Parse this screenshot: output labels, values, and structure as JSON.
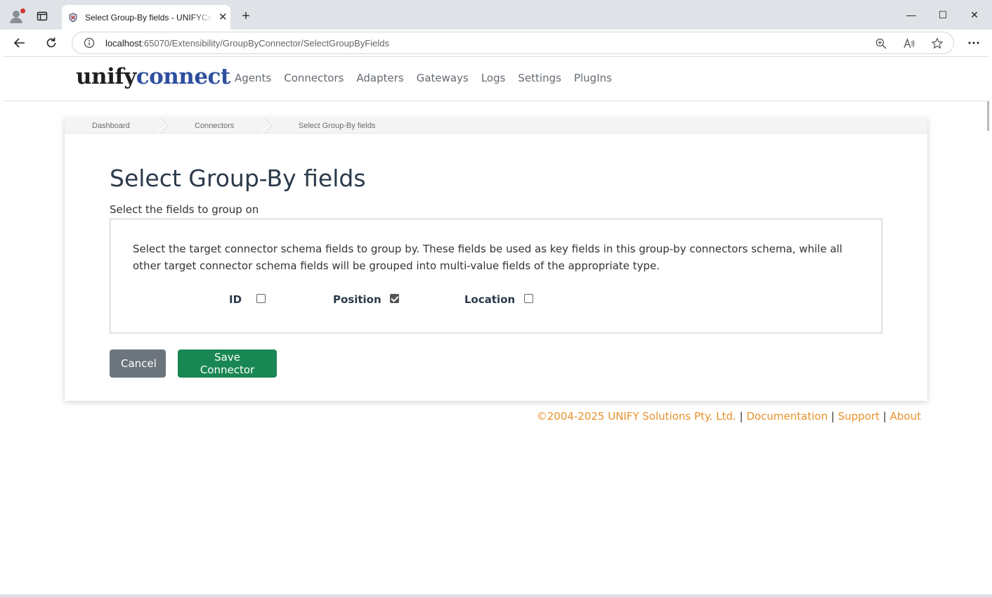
{
  "browser": {
    "tab_title": "Select Group-By fields - UNIFYConnect",
    "tab_close": "✕",
    "new_tab": "+",
    "url_host": "localhost",
    "url_rest": ":65070/Extensibility/GroupByConnector/SelectGroupByFields",
    "window_controls": {
      "minimize": "—",
      "maximize": "☐",
      "close": "✕"
    }
  },
  "brand": {
    "part1": "unify",
    "part2": "connect"
  },
  "nav": {
    "items": [
      {
        "label": "Agents"
      },
      {
        "label": "Connectors"
      },
      {
        "label": "Adapters"
      },
      {
        "label": "Gateways"
      },
      {
        "label": "Logs"
      },
      {
        "label": "Settings"
      },
      {
        "label": "PlugIns"
      }
    ]
  },
  "breadcrumb": [
    {
      "label": "Dashboard"
    },
    {
      "label": "Connectors"
    },
    {
      "label": "Select Group-By fields"
    }
  ],
  "page": {
    "title": "Select Group-By fields",
    "subtitle": "Select the fields to group on",
    "description": "Select the target connector schema fields to group by. These fields be used as key fields in this group-by connectors schema, while all other target connector schema fields will be grouped into multi-value fields of the appropriate type."
  },
  "fields": [
    {
      "label": "ID",
      "checked": false
    },
    {
      "label": "Position",
      "checked": true
    },
    {
      "label": "Location",
      "checked": false
    }
  ],
  "buttons": {
    "cancel": "Cancel",
    "save": "Save Connector"
  },
  "footer": {
    "copyright": "©2004-2025 UNIFY Solutions Pty. Ltd.",
    "separator": "|",
    "links": [
      {
        "label": "Documentation"
      },
      {
        "label": "Support"
      },
      {
        "label": "About"
      }
    ]
  },
  "colors": {
    "brand_dark": "#1f1f1f",
    "brand_blue": "#2f4f9e",
    "footer_link": "#e8912d",
    "cancel_button": "#6c757d",
    "save_button": "#198754"
  }
}
